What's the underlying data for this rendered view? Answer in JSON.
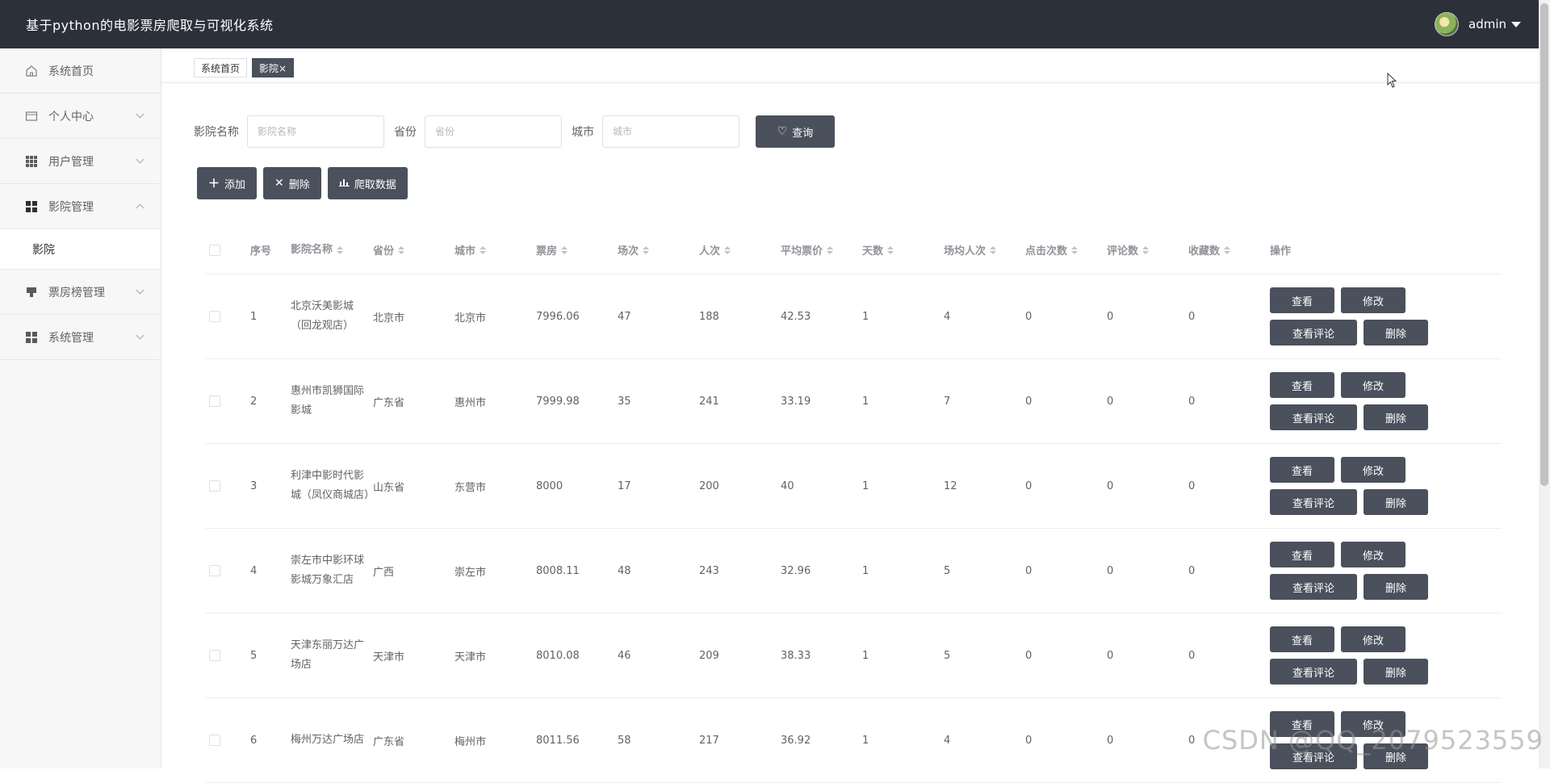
{
  "header": {
    "title": "基于python的电影票房爬取与可视化系统",
    "username": "admin"
  },
  "sidebar": {
    "items": [
      {
        "label": "系统首页",
        "icon": "home-icon"
      },
      {
        "label": "个人中心",
        "icon": "card-icon"
      },
      {
        "label": "用户管理",
        "icon": "grid-icon"
      },
      {
        "label": "影院管理",
        "icon": "apps-icon"
      },
      {
        "label": "票房榜管理",
        "icon": "podium-icon"
      },
      {
        "label": "系统管理",
        "icon": "apps-icon"
      }
    ],
    "submenu": {
      "label": "影院"
    }
  },
  "tabs": [
    {
      "label": "系统首页"
    },
    {
      "label": "影院×"
    }
  ],
  "search": {
    "name_label": "影院名称",
    "name_placeholder": "影院名称",
    "province_label": "省份",
    "province_placeholder": "省份",
    "city_label": "城市",
    "city_placeholder": "城市",
    "query_label": "查询"
  },
  "actions": {
    "add": "添加",
    "delete": "删除",
    "crawl": "爬取数据"
  },
  "table": {
    "headers": [
      "序号",
      "影院名称",
      "省份",
      "城市",
      "票房",
      "场次",
      "人次",
      "平均票价",
      "天数",
      "场均人次",
      "点击次数",
      "评论数",
      "收藏数",
      "操作"
    ],
    "op_labels": {
      "view": "查看",
      "edit": "修改",
      "comments": "查看评论",
      "delete": "删除"
    },
    "rows": [
      {
        "no": "1",
        "name": "北京沃美影城（回龙观店）",
        "province": "北京市",
        "city": "北京市",
        "box": "7996.06",
        "sessions": "47",
        "people": "188",
        "avg": "42.53",
        "days": "1",
        "per": "4",
        "clicks": "0",
        "comments": "0",
        "favs": "0"
      },
      {
        "no": "2",
        "name": "惠州市凯狮国际影城",
        "province": "广东省",
        "city": "惠州市",
        "box": "7999.98",
        "sessions": "35",
        "people": "241",
        "avg": "33.19",
        "days": "1",
        "per": "7",
        "clicks": "0",
        "comments": "0",
        "favs": "0"
      },
      {
        "no": "3",
        "name": "利津中影时代影城（凤仪商城店）",
        "province": "山东省",
        "city": "东营市",
        "box": "8000",
        "sessions": "17",
        "people": "200",
        "avg": "40",
        "days": "1",
        "per": "12",
        "clicks": "0",
        "comments": "0",
        "favs": "0"
      },
      {
        "no": "4",
        "name": "崇左市中影环球影城万象汇店",
        "province": "广西",
        "city": "崇左市",
        "box": "8008.11",
        "sessions": "48",
        "people": "243",
        "avg": "32.96",
        "days": "1",
        "per": "5",
        "clicks": "0",
        "comments": "0",
        "favs": "0"
      },
      {
        "no": "5",
        "name": "天津东丽万达广场店",
        "province": "天津市",
        "city": "天津市",
        "box": "8010.08",
        "sessions": "46",
        "people": "209",
        "avg": "38.33",
        "days": "1",
        "per": "5",
        "clicks": "0",
        "comments": "0",
        "favs": "0"
      },
      {
        "no": "6",
        "name": "梅州万达广场店",
        "province": "广东省",
        "city": "梅州市",
        "box": "8011.56",
        "sessions": "58",
        "people": "217",
        "avg": "36.92",
        "days": "1",
        "per": "4",
        "clicks": "0",
        "comments": "0",
        "favs": "0"
      }
    ]
  },
  "watermark": "CSDN @QQ_2079523559"
}
